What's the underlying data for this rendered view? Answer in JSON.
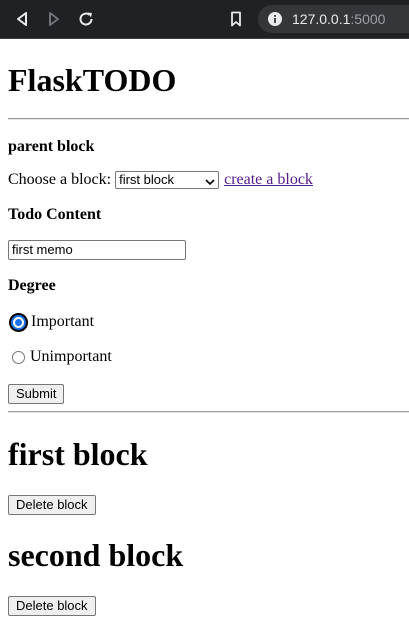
{
  "browser": {
    "url_host": "127.0.0.1",
    "url_port": ":5000",
    "icons": [
      "back-arrow-icon",
      "forward-arrow-icon",
      "reload-icon",
      "bookmark-icon",
      "info-icon"
    ]
  },
  "page": {
    "title": "FlaskTODO",
    "form": {
      "parent_label": "parent block",
      "choose_label": "Choose a block:",
      "block_select_value": "first block",
      "create_link": "create a block",
      "content_label": "Todo Content",
      "content_value": "first memo",
      "degree_label": "Degree",
      "radio_important": "Important",
      "radio_unimportant": "Unimportant",
      "selected_degree": "Important",
      "submit_label": "Submit"
    },
    "blocks": [
      {
        "title": "first block",
        "delete_label": "Delete block"
      },
      {
        "title": "second block",
        "delete_label": "Delete block"
      }
    ]
  }
}
